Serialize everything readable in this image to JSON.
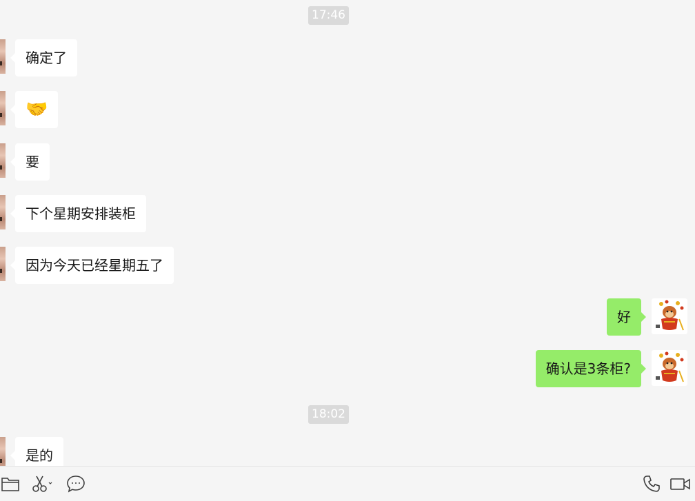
{
  "timestamps": [
    "17:46",
    "18:02"
  ],
  "messages": [
    {
      "side": "left",
      "text": "确定了"
    },
    {
      "side": "left",
      "text": "🤝"
    },
    {
      "side": "left",
      "text": "要"
    },
    {
      "side": "left",
      "text": "下个星期安排装柜"
    },
    {
      "side": "left",
      "text": "因为今天已经星期五了"
    },
    {
      "side": "right",
      "text": "好"
    },
    {
      "side": "right",
      "text": "确认是3条柜?"
    },
    {
      "side": "left",
      "text": "是的"
    }
  ],
  "toolbar": {
    "left_icons": [
      "folder-icon",
      "scissors-icon",
      "chat-bubble-icon"
    ],
    "right_icons": [
      "phone-icon",
      "video-call-icon"
    ]
  },
  "colors": {
    "background": "#f5f5f5",
    "incoming_bubble": "#ffffff",
    "outgoing_bubble": "#95ec69",
    "timestamp_badge": "#dadada"
  }
}
